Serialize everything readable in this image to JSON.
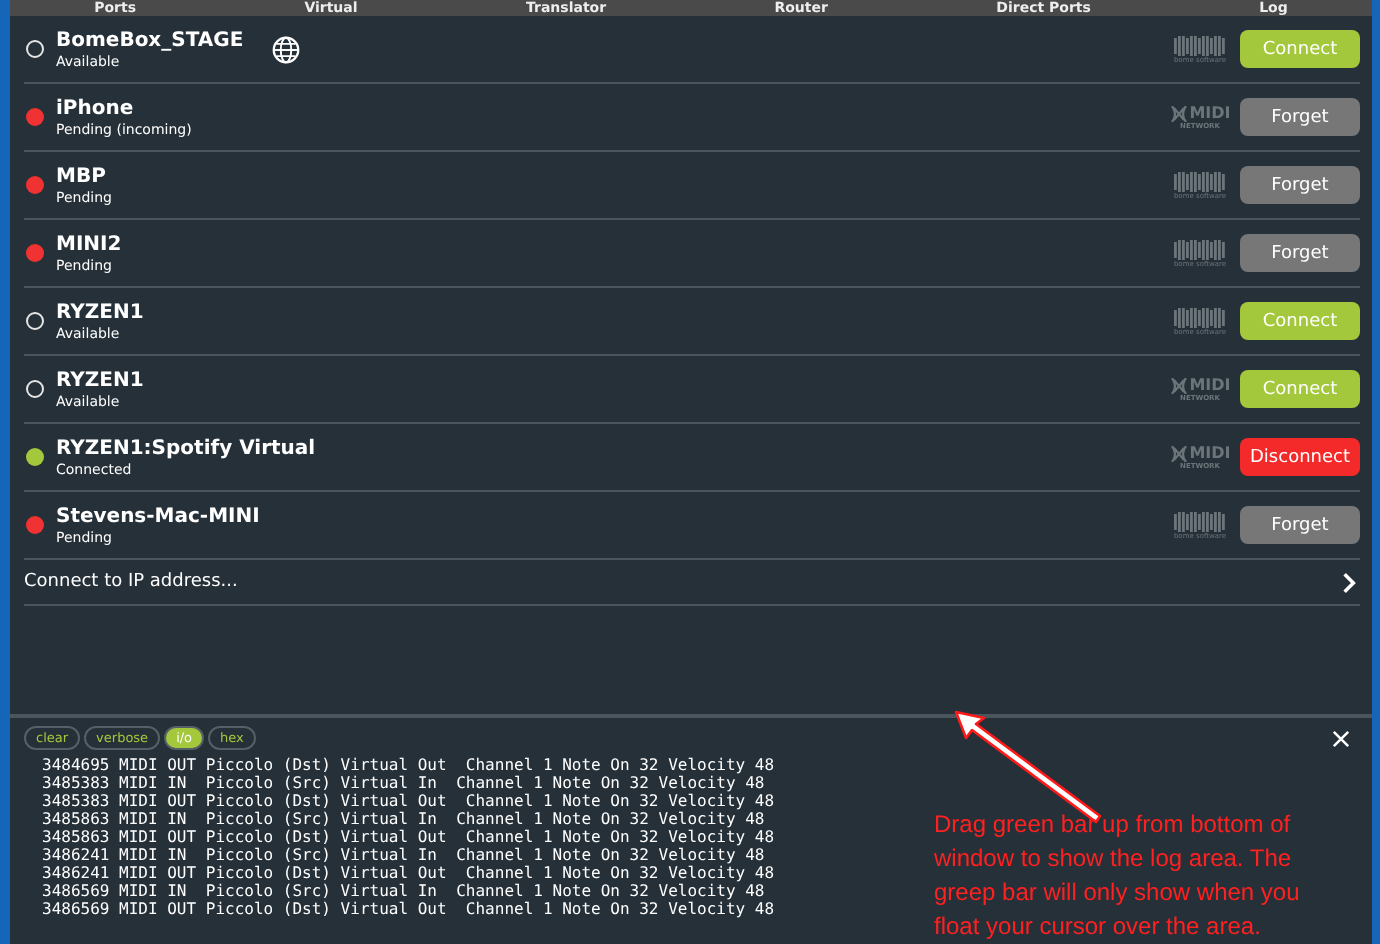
{
  "tabs": [
    {
      "label": "Ports",
      "selected": false
    },
    {
      "label": "Virtual",
      "selected": false
    },
    {
      "label": "Translator",
      "selected": false
    },
    {
      "label": "Router",
      "selected": false
    },
    {
      "label": "Direct Ports",
      "selected": false
    },
    {
      "label": "Log",
      "selected": false
    }
  ],
  "devices": [
    {
      "name": "BomeBox_STAGE",
      "status": "Available",
      "pending": false,
      "connected": false,
      "globe": true,
      "logo": {
        "kind": "bome",
        "subtext": "bome software"
      },
      "button": {
        "label": "Connect",
        "kind": "connect"
      }
    },
    {
      "name": "iPhone",
      "status": "Pending (incoming)",
      "pending": true,
      "connected": false,
      "globe": false,
      "logo": {
        "kind": "midi",
        "text": "MIDI",
        "subtext": "NETWORK"
      },
      "button": {
        "label": "Forget",
        "kind": "forget"
      }
    },
    {
      "name": "MBP",
      "status": "Pending",
      "pending": true,
      "connected": false,
      "globe": false,
      "logo": {
        "kind": "bome",
        "subtext": "bome software"
      },
      "button": {
        "label": "Forget",
        "kind": "forget"
      }
    },
    {
      "name": "MINI2",
      "status": "Pending",
      "pending": true,
      "connected": false,
      "globe": false,
      "logo": {
        "kind": "bome",
        "subtext": "bome software"
      },
      "button": {
        "label": "Forget",
        "kind": "forget"
      }
    },
    {
      "name": "RYZEN1",
      "status": "Available",
      "pending": false,
      "connected": false,
      "globe": false,
      "logo": {
        "kind": "bome",
        "subtext": "bome software"
      },
      "button": {
        "label": "Connect",
        "kind": "connect"
      }
    },
    {
      "name": "RYZEN1",
      "status": "Available",
      "pending": false,
      "connected": false,
      "globe": false,
      "logo": {
        "kind": "midi",
        "text": "MIDI",
        "subtext": "NETWORK"
      },
      "button": {
        "label": "Connect",
        "kind": "connect"
      }
    },
    {
      "name": "RYZEN1:Spotify Virtual",
      "status": "Connected",
      "pending": false,
      "connected": true,
      "globe": false,
      "logo": {
        "kind": "midi",
        "text": "MIDI",
        "subtext": "NETWORK"
      },
      "button": {
        "label": "Disconnect",
        "kind": "disconnect"
      }
    },
    {
      "name": "Stevens-Mac-MINI",
      "status": "Pending",
      "pending": true,
      "connected": false,
      "globe": false,
      "logo": {
        "kind": "bome",
        "subtext": "bome software"
      },
      "button": {
        "label": "Forget",
        "kind": "forget"
      }
    }
  ],
  "connect_ip": {
    "label": "Connect to IP address..."
  },
  "log": {
    "toggles": [
      {
        "label": "clear",
        "selected": false
      },
      {
        "label": "verbose",
        "selected": false
      },
      {
        "label": "i/o",
        "selected": true
      },
      {
        "label": "hex",
        "selected": false
      }
    ],
    "lines": [
      "3484695 MIDI OUT Piccolo (Dst) Virtual Out  Channel 1 Note On 32 Velocity 48",
      "3485383 MIDI IN  Piccolo (Src) Virtual In  Channel 1 Note On 32 Velocity 48",
      "3485383 MIDI OUT Piccolo (Dst) Virtual Out  Channel 1 Note On 32 Velocity 48",
      "3485863 MIDI IN  Piccolo (Src) Virtual In  Channel 1 Note On 32 Velocity 48",
      "3485863 MIDI OUT Piccolo (Dst) Virtual Out  Channel 1 Note On 32 Velocity 48",
      "3486241 MIDI IN  Piccolo (Src) Virtual In  Channel 1 Note On 32 Velocity 48",
      "3486241 MIDI OUT Piccolo (Dst) Virtual Out  Channel 1 Note On 32 Velocity 48",
      "3486569 MIDI IN  Piccolo (Src) Virtual In  Channel 1 Note On 32 Velocity 48",
      "3486569 MIDI OUT Piccolo (Dst) Virtual Out  Channel 1 Note On 32 Velocity 48"
    ]
  },
  "annotation": {
    "text": "Drag green bar up from bottom of window to show the log area.  The greep bar will only show when you float your cursor over the area."
  }
}
